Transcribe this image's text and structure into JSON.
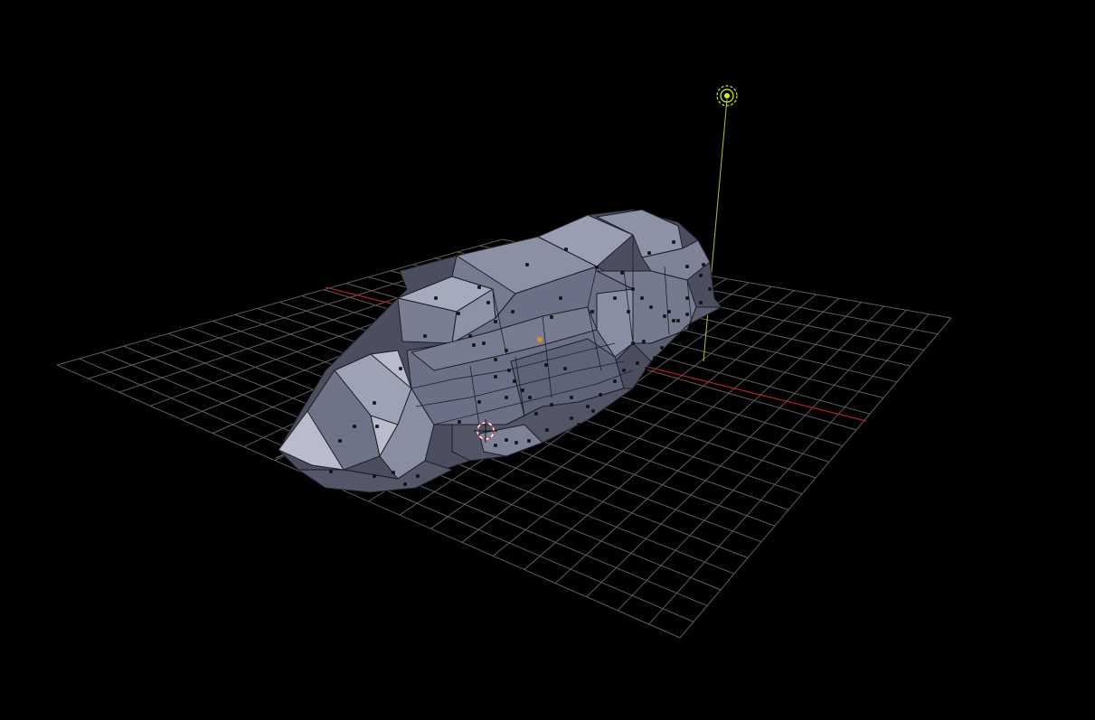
{
  "viewport": {
    "background": "#000000",
    "grid_color": "#5e5e5e",
    "x_axis_color": "#b3232d",
    "y_axis_color": "#3f9a3f",
    "light_color": "#d6f000",
    "mesh_fill": "#6c7086",
    "mesh_light": "#a3a8bd",
    "mesh_dark": "#3e4152",
    "vertex_color": "#111111",
    "origin_color": "#e08a2a",
    "cursor_color": "#e03a3a"
  },
  "objects": [
    {
      "name": "spaceship-mesh",
      "type": "mesh",
      "mode": "edit"
    },
    {
      "name": "lamp",
      "type": "light"
    },
    {
      "name": "3d-cursor",
      "type": "cursor"
    }
  ]
}
